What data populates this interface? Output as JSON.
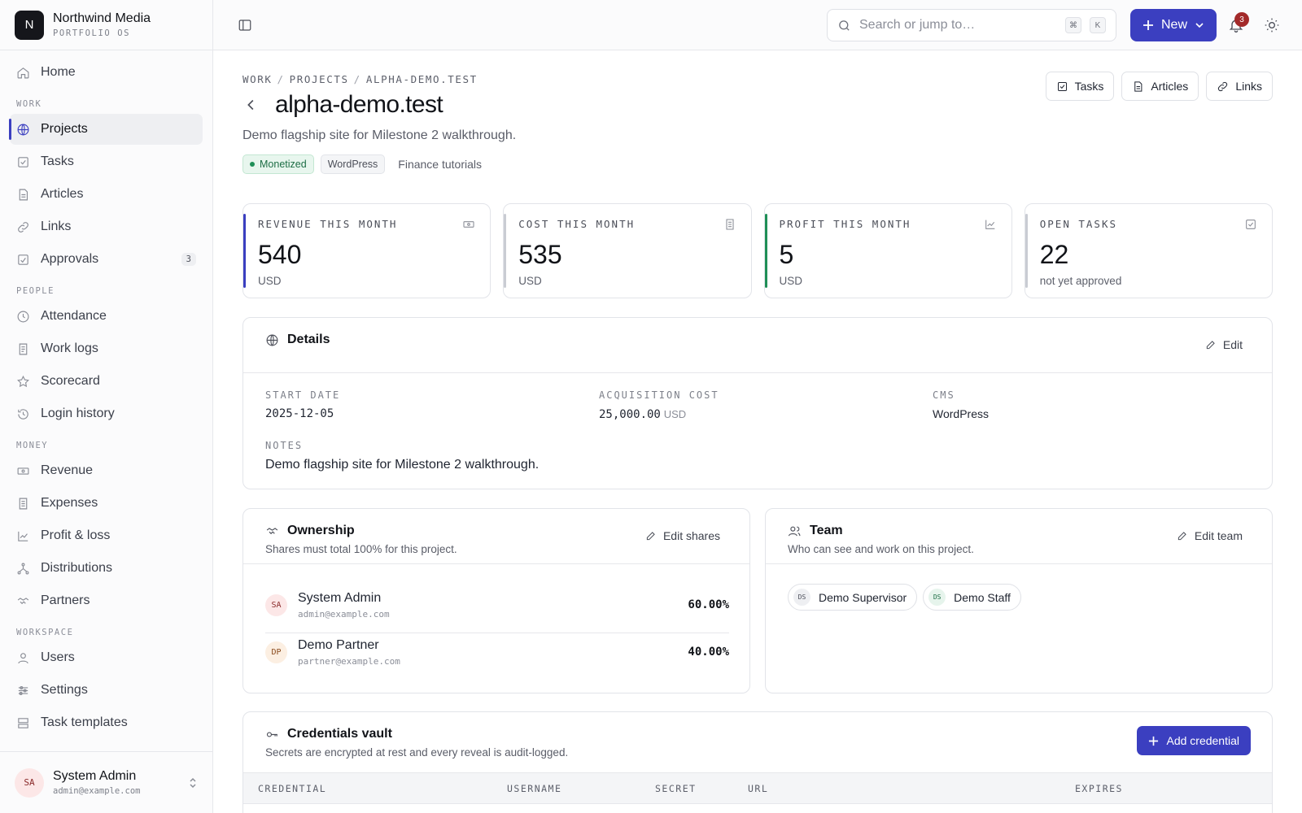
{
  "brand": {
    "initial": "N",
    "name": "Northwind Media",
    "sub": "PORTFOLIO OS"
  },
  "sidebar": {
    "home": "Home",
    "sections": {
      "work": "WORK",
      "people": "PEOPLE",
      "money": "MONEY",
      "workspace": "WORKSPACE"
    },
    "work": [
      {
        "label": "Projects",
        "icon": "globe-icon"
      },
      {
        "label": "Tasks",
        "icon": "check-square-icon"
      },
      {
        "label": "Articles",
        "icon": "document-icon"
      },
      {
        "label": "Links",
        "icon": "link-icon"
      },
      {
        "label": "Approvals",
        "icon": "approve-icon",
        "badge": "3"
      }
    ],
    "people": [
      {
        "label": "Attendance",
        "icon": "clock-icon"
      },
      {
        "label": "Work logs",
        "icon": "log-icon"
      },
      {
        "label": "Scorecard",
        "icon": "star-icon"
      },
      {
        "label": "Login history",
        "icon": "history-icon"
      }
    ],
    "money": [
      {
        "label": "Revenue",
        "icon": "cash-icon"
      },
      {
        "label": "Expenses",
        "icon": "receipt-icon"
      },
      {
        "label": "Profit & loss",
        "icon": "chart-icon"
      },
      {
        "label": "Distributions",
        "icon": "branch-icon"
      },
      {
        "label": "Partners",
        "icon": "handshake-icon"
      }
    ],
    "workspace": [
      {
        "label": "Users",
        "icon": "user-icon"
      },
      {
        "label": "Settings",
        "icon": "sliders-icon"
      },
      {
        "label": "Task templates",
        "icon": "template-icon"
      }
    ]
  },
  "user": {
    "initials": "SA",
    "name": "System Admin",
    "email": "admin@example.com"
  },
  "topbar": {
    "search_placeholder": "Search or jump to…",
    "kbd1": "⌘",
    "kbd2": "K",
    "new_label": "New",
    "notifications": "3"
  },
  "page": {
    "breadcrumb": [
      "WORK",
      "PROJECTS",
      "ALPHA-DEMO.TEST"
    ],
    "title": "alpha-demo.test",
    "subtitle": "Demo flagship site for Milestone 2 walkthrough.",
    "tags": {
      "status": "Monetized",
      "cms": "WordPress",
      "niche": "Finance tutorials"
    },
    "quick": {
      "tasks": "Tasks",
      "articles": "Articles",
      "links": "Links"
    }
  },
  "stats": [
    {
      "label": "REVENUE THIS MONTH",
      "value": "540",
      "unit": "USD"
    },
    {
      "label": "COST THIS MONTH",
      "value": "535",
      "unit": "USD"
    },
    {
      "label": "PROFIT THIS MONTH",
      "value": "5",
      "unit": "USD"
    },
    {
      "label": "OPEN TASKS",
      "value": "22",
      "unit": "not yet approved"
    }
  ],
  "details": {
    "title": "Details",
    "edit": "Edit",
    "start_label": "START DATE",
    "start_value": "2025-12-05",
    "acq_label": "ACQUISITION COST",
    "acq_value": "25,000.00",
    "acq_unit": "USD",
    "cms_label": "CMS",
    "cms_value": "WordPress",
    "notes_label": "NOTES",
    "notes_value": "Demo flagship site for Milestone 2 walkthrough."
  },
  "ownership": {
    "title": "Ownership",
    "subtitle": "Shares must total 100% for this project.",
    "edit": "Edit shares",
    "owners": [
      {
        "initials": "SA",
        "name": "System Admin",
        "email": "admin@example.com",
        "share": "60.00%"
      },
      {
        "initials": "DP",
        "name": "Demo Partner",
        "email": "partner@example.com",
        "share": "40.00%"
      }
    ]
  },
  "team": {
    "title": "Team",
    "subtitle": "Who can see and work on this project.",
    "edit": "Edit team",
    "members": [
      {
        "initials": "DS",
        "name": "Demo Supervisor"
      },
      {
        "initials": "DS",
        "name": "Demo Staff"
      }
    ]
  },
  "vault": {
    "title": "Credentials vault",
    "subtitle": "Secrets are encrypted at rest and every reveal is audit-logged.",
    "add": "Add credential",
    "columns": [
      "CREDENTIAL",
      "USERNAME",
      "SECRET",
      "URL",
      "EXPIRES"
    ]
  },
  "colors": {
    "accent": "#3b3fc0",
    "success": "#1f8f57",
    "danger": "#a32a2a"
  }
}
